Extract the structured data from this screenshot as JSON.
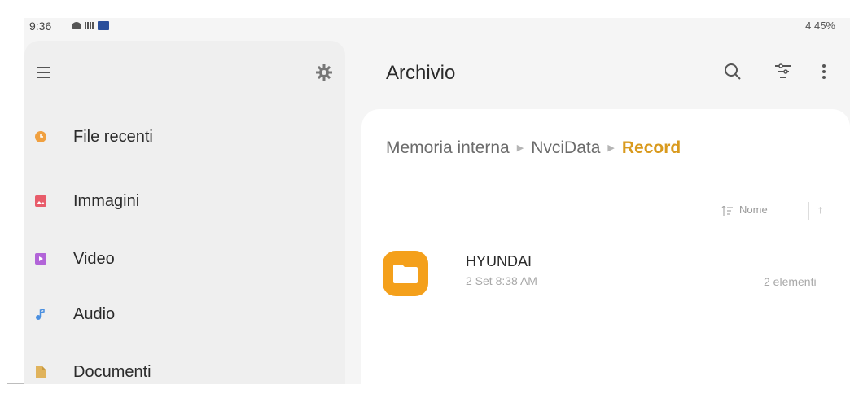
{
  "status_bar": {
    "time": "9:36",
    "right": "4 45%"
  },
  "toolbar": {
    "title": "Archivio"
  },
  "sidebar": {
    "items": [
      {
        "label": "File recenti",
        "icon": "recent-files-icon",
        "color": "#f0a040"
      },
      {
        "label": "Immagini",
        "icon": "images-icon",
        "color": "#e85c6a"
      },
      {
        "label": "Video",
        "icon": "video-icon",
        "color": "#b264d8"
      },
      {
        "label": "Audio",
        "icon": "audio-icon",
        "color": "#4a8fe0"
      },
      {
        "label": "Documenti",
        "icon": "documents-icon",
        "color": "#e0b35c"
      }
    ]
  },
  "breadcrumb": {
    "items": [
      "Memoria interna",
      "NvciData"
    ],
    "current": "Record"
  },
  "sort": {
    "label": "Nome"
  },
  "files": [
    {
      "name": "HYUNDAI",
      "date": "2 Set 8:38 AM",
      "count": "2 elementi"
    }
  ],
  "colors": {
    "accent": "#d99a1e",
    "folder": "#f4a01b"
  }
}
